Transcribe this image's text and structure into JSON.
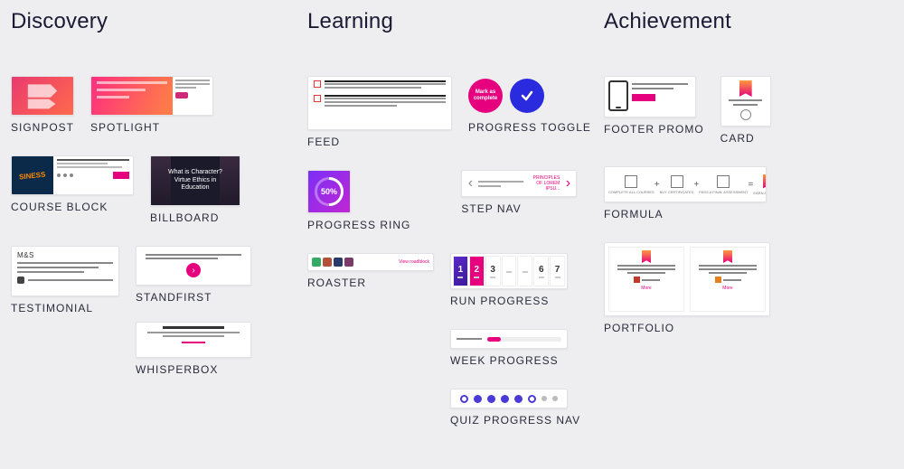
{
  "columns": {
    "discovery": {
      "heading": "Discovery",
      "items": {
        "signpost": "SIGNPOST",
        "spotlight": "SPOTLIGHT",
        "course_block": "COURSE BLOCK",
        "billboard": "BILLBOARD",
        "testimonial": "TESTIMONIAL",
        "standfirst": "STANDFIRST",
        "whisperbox": "WHISPERBOX"
      }
    },
    "learning": {
      "heading": "Learning",
      "items": {
        "feed": "FEED",
        "progress_toggle": "PROGRESS TOGGLE",
        "progress_ring": "PROGRESS RING",
        "step_nav": "STEP NAV",
        "roaster": "ROASTER",
        "run_progress": "RUN PROGRESS",
        "week_progress": "WEEK PROGRESS",
        "quiz_progress_nav": "QUIZ PROGRESS NAV"
      }
    },
    "achievement": {
      "heading": "Achievement",
      "items": {
        "footer_promo": "FOOTER PROMO",
        "card": "CARD",
        "formula": "FORMULA",
        "portfolio": "PORTFOLIO"
      }
    }
  },
  "thumbs": {
    "billboard_title": "What is Character? Virtue Ethics in Education",
    "progress_ring_pct": "50%",
    "progress_toggle_mark": "Mark as complete",
    "run_steps": [
      "1",
      "2",
      "3",
      "",
      "",
      "6",
      "7"
    ],
    "testimonial_brand": "M&S",
    "course_block_badge": "SINESS",
    "standfirst_arrow": "›",
    "roaster_link": "View roadblock",
    "step_nav_right": "PRINCIPLES OF LOREM IPSU...",
    "formula_nodes": [
      "COMPLETE ALL COURSES",
      "BUY CERTIFICATES",
      "PASS A FINAL ASSESSMENT",
      "EARN AN AWARD"
    ],
    "portfolio_more": "More"
  }
}
